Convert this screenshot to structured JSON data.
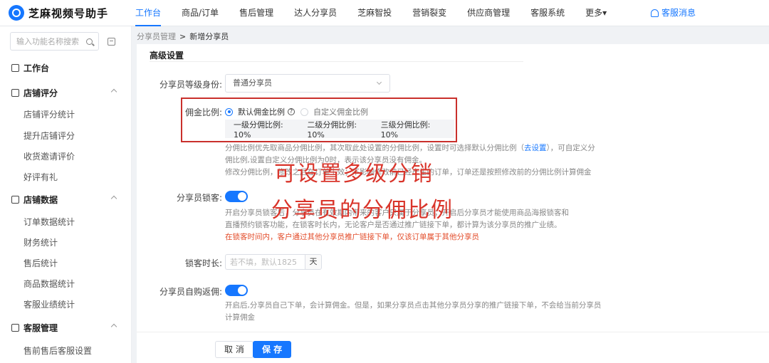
{
  "app": {
    "name": "芝麻视频号助手"
  },
  "nav": {
    "items": [
      "工作台",
      "商品/订单",
      "售后管理",
      "达人分享员",
      "芝麻智投",
      "营销裂变",
      "供应商管理",
      "客服系统",
      "更多▾"
    ],
    "notice": "客服消息"
  },
  "sidebar": {
    "search_placeholder": "输入功能名称搜索",
    "groups": [
      {
        "label": "工作台",
        "items": []
      },
      {
        "label": "店铺评分",
        "items": [
          "店铺评分统计",
          "提升店铺评分",
          "收货邀请评价",
          "好评有礼"
        ]
      },
      {
        "label": "店铺数据",
        "items": [
          "订单数据统计",
          "财务统计",
          "售后统计",
          "商品数据统计",
          "客服业绩统计"
        ]
      },
      {
        "label": "客服管理",
        "items": [
          "售前售后客服设置"
        ]
      }
    ]
  },
  "breadcrumb": {
    "parent": "分享员管理",
    "separator": ">",
    "current": "新增分享员"
  },
  "form": {
    "section_title": "高级设置",
    "level": {
      "label": "分享员等级身份:",
      "value": "普通分享员"
    },
    "commission": {
      "label": "佣金比例:",
      "option_default": "默认佣金比例",
      "option_custom": "自定义佣金比例",
      "ratio_1": "一级分佣比例: 10%",
      "ratio_2": "二级分佣比例: 10%",
      "ratio_3": "三级分佣比例: 10%",
      "desc_1a": "分佣比例优先取商品分佣比例，其次取此处设置的分佣比例，设置时可选择默认分佣比例（",
      "desc_1_link": "去设置",
      "desc_1b": "），可自定义分",
      "desc_2": "佣比例,设置自定义分佣比例为0时，表示该分享员没有佣金。",
      "desc_3": "修改分佣比例，修改之后在订单生效；不影响修改前已经产生的订单，订单还是按照修改前的分佣比例计算佣金"
    },
    "lock": {
      "label": "分享员锁客:",
      "desc_1": "开启分享员锁客后，分享员在有效期内带来的客户只属于分享员；开启后分享员才能使用商品海报锁客和",
      "desc_2": "直播预约锁客功能，在锁客时长内，无论客户是否通过推广链接下单，都计算为该分享员的推广业绩。",
      "desc_red": "在锁客时间内，客户通过其他分享员推广链接下单，仅该订单属于其他分享员"
    },
    "lock_time": {
      "label": "锁客时长:",
      "placeholder": "若不填，默认1825",
      "unit": "天"
    },
    "self_rebate": {
      "label": "分享员自购返佣:",
      "desc_1": "开启后,分享员自己下单，会计算佣金。但是，如果分享员点击其他分享员分享的推广链接下单，不会给当前分享员",
      "desc_2": "计算佣金"
    }
  },
  "overlay": {
    "line_1": "可设置多级分销",
    "line_2": "分享员的分佣比例"
  },
  "footer": {
    "cancel": "取 消",
    "save": "保 存"
  },
  "colors": {
    "primary": "#1677ff",
    "annotation_red": "#d9352b"
  }
}
